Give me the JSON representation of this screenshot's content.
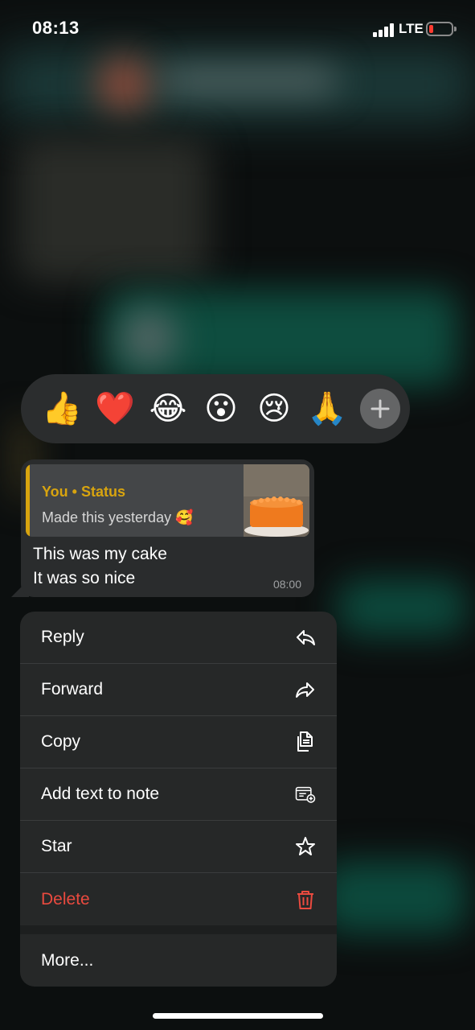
{
  "status_bar": {
    "time": "08:13",
    "network": "LTE"
  },
  "reactions": {
    "emojis": [
      "👍",
      "❤️",
      "😂",
      "😮",
      "😢",
      "🙏"
    ],
    "more_icon": "plus-icon"
  },
  "message": {
    "quote": {
      "title": "You • Status",
      "text": "Made this yesterday 🥰"
    },
    "lines": [
      "This was my cake",
      "It was so nice"
    ],
    "time": "08:00"
  },
  "menu": {
    "items": [
      {
        "label": "Reply",
        "icon": "reply-icon"
      },
      {
        "label": "Forward",
        "icon": "forward-icon"
      },
      {
        "label": "Copy",
        "icon": "copy-icon"
      },
      {
        "label": "Add text to note",
        "icon": "add-note-icon"
      },
      {
        "label": "Star",
        "icon": "star-icon"
      },
      {
        "label": "Delete",
        "icon": "trash-icon"
      }
    ],
    "more_label": "More..."
  },
  "colors": {
    "accent": "#d8a40f",
    "danger": "#ea4a3f",
    "menu_bg": "#262828"
  }
}
